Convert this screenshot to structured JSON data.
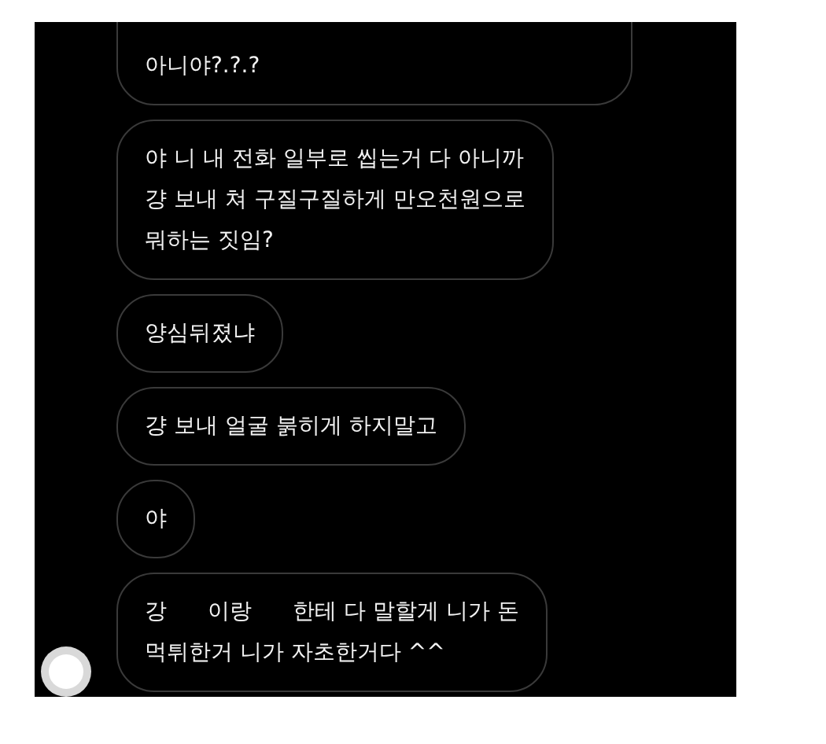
{
  "messages": [
    {
      "lines": [
        [
          {
            "kind": "text",
            "text": "아니야?.?.?"
          }
        ]
      ],
      "cut_top": true
    },
    {
      "lines": [
        [
          {
            "kind": "text",
            "text": "야 니 내 전화 일부로 씹는거 다 아니까"
          }
        ],
        [
          {
            "kind": "text",
            "text": "걍 보내 쳐 구질구질하게 만오천원으로"
          }
        ],
        [
          {
            "kind": "text",
            "text": "뭐하는 짓임?"
          }
        ]
      ],
      "cut_top": false
    },
    {
      "lines": [
        [
          {
            "kind": "text",
            "text": "양심뒤졌냐"
          }
        ]
      ],
      "cut_top": false
    },
    {
      "lines": [
        [
          {
            "kind": "text",
            "text": "걍 보내 얼굴 붉히게 하지말고"
          }
        ]
      ],
      "cut_top": false
    },
    {
      "lines": [
        [
          {
            "kind": "text",
            "text": "야"
          }
        ]
      ],
      "cut_top": false
    },
    {
      "lines": [
        [
          {
            "kind": "text",
            "text": "강"
          },
          {
            "kind": "gap"
          },
          {
            "kind": "text",
            "text": "이랑"
          },
          {
            "kind": "gap"
          },
          {
            "kind": "text",
            "text": "한테 다 말할게 니가 돈"
          }
        ],
        [
          {
            "kind": "text",
            "text": "먹튀한거 니가 자초한거다 ^^"
          }
        ]
      ],
      "cut_top": false,
      "avatar": true
    }
  ]
}
